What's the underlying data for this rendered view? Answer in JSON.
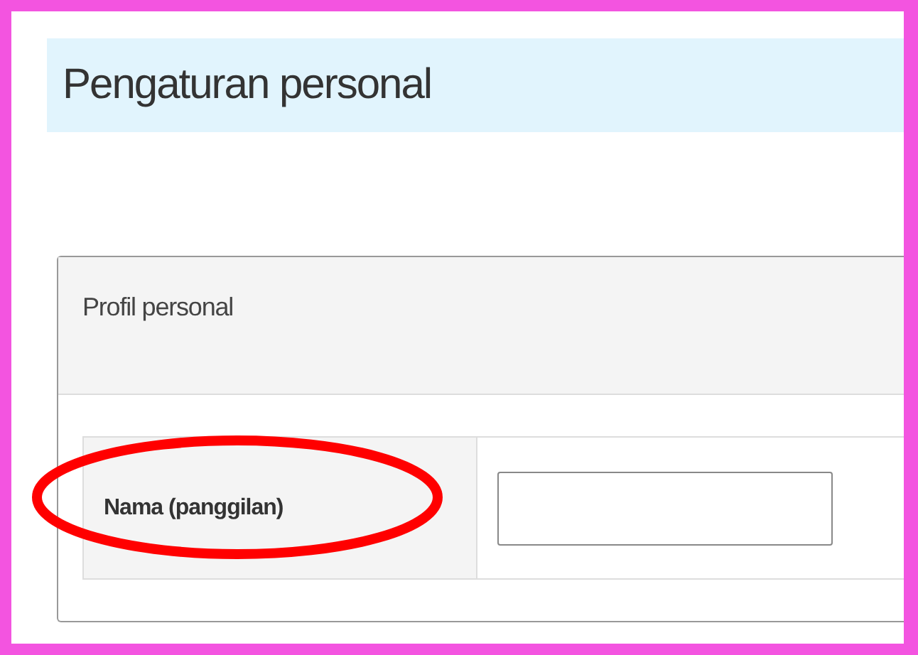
{
  "page_title": "Pengaturan personal",
  "panel": {
    "title": "Profil personal",
    "fields": [
      {
        "label": "Nama (panggilan)"
      }
    ]
  }
}
